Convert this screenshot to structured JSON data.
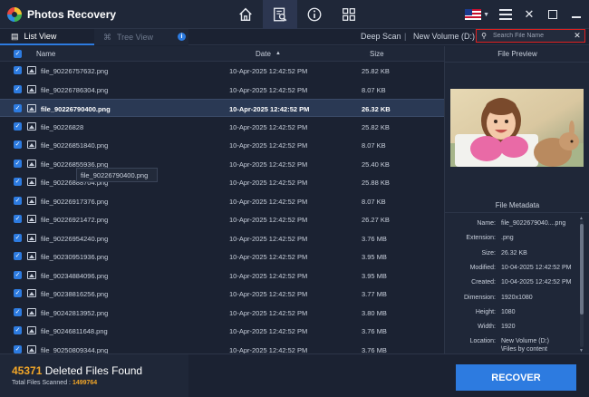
{
  "app": {
    "title": "Photos Recovery"
  },
  "nav": {
    "icons": [
      "home-icon",
      "scan-results-icon",
      "info-icon",
      "grid-icon"
    ]
  },
  "window": {
    "language_flag": "us-flag",
    "menu_icon": "hamburger-icon"
  },
  "tabs": [
    {
      "label": "List View",
      "active": true
    },
    {
      "label": "Tree View",
      "active": false
    }
  ],
  "scan": {
    "type": "Deep Scan",
    "separator": "|",
    "volume": "New Volume (D:)"
  },
  "search": {
    "placeholder": "Search File Name",
    "value": ""
  },
  "list": {
    "columns": {
      "name": "Name",
      "date": "Date",
      "size": "Size"
    },
    "sort": {
      "column": "date",
      "direction": "ascending"
    },
    "rows": [
      {
        "name": "file_90226757632.png",
        "date": "10-Apr-2025 12:42:52 PM",
        "size": "25.82 KB",
        "selected": false
      },
      {
        "name": "file_90226786304.png",
        "date": "10-Apr-2025 12:42:52 PM",
        "size": "8.07 KB",
        "selected": false
      },
      {
        "name": "file_90226790400.png",
        "date": "10-Apr-2025 12:42:52 PM",
        "size": "26.32 KB",
        "selected": true
      },
      {
        "name": "file_90226828",
        "date": "10-Apr-2025 12:42:52 PM",
        "size": "25.82 KB",
        "selected": false
      },
      {
        "name": "file_90226851840.png",
        "date": "10-Apr-2025 12:42:52 PM",
        "size": "8.07 KB",
        "selected": false
      },
      {
        "name": "file_90226855936.png",
        "date": "10-Apr-2025 12:42:52 PM",
        "size": "25.40 KB",
        "selected": false
      },
      {
        "name": "file_90226888704.png",
        "date": "10-Apr-2025 12:42:52 PM",
        "size": "25.88 KB",
        "selected": false
      },
      {
        "name": "file_90226917376.png",
        "date": "10-Apr-2025 12:42:52 PM",
        "size": "8.07 KB",
        "selected": false
      },
      {
        "name": "file_90226921472.png",
        "date": "10-Apr-2025 12:42:52 PM",
        "size": "26.27 KB",
        "selected": false
      },
      {
        "name": "file_90226954240.png",
        "date": "10-Apr-2025 12:42:52 PM",
        "size": "3.76 MB",
        "selected": false
      },
      {
        "name": "file_90230951936.png",
        "date": "10-Apr-2025 12:42:52 PM",
        "size": "3.95 MB",
        "selected": false
      },
      {
        "name": "file_90234884096.png",
        "date": "10-Apr-2025 12:42:52 PM",
        "size": "3.95 MB",
        "selected": false
      },
      {
        "name": "file_90238816256.png",
        "date": "10-Apr-2025 12:42:52 PM",
        "size": "3.77 MB",
        "selected": false
      },
      {
        "name": "file_90242813952.png",
        "date": "10-Apr-2025 12:42:52 PM",
        "size": "3.80 MB",
        "selected": false
      },
      {
        "name": "file_90246811648.png",
        "date": "10-Apr-2025 12:42:52 PM",
        "size": "3.76 MB",
        "selected": false
      },
      {
        "name": "file_90250809344.png",
        "date": "10-Apr-2025 12:42:52 PM",
        "size": "3.76 MB",
        "selected": false
      }
    ],
    "tooltip": "file_90226790400.png"
  },
  "preview": {
    "title": "File Preview"
  },
  "metadata": {
    "title": "File Metadata",
    "rows": [
      {
        "key": "Name:",
        "value": "file_9022679040....png"
      },
      {
        "key": "Extension:",
        "value": ".png"
      },
      {
        "key": "Size:",
        "value": "26.32 KB"
      },
      {
        "key": "Modified:",
        "value": "10-04-2025 12:42:52 PM"
      },
      {
        "key": "Created:",
        "value": "10-04-2025 12:42:52 PM"
      },
      {
        "key": "Dimension:",
        "value": "1920x1080"
      },
      {
        "key": "Height:",
        "value": "1080"
      },
      {
        "key": "Width:",
        "value": "1920"
      },
      {
        "key": "Location:",
        "value": "New Volume (D:)"
      },
      {
        "key": "",
        "value": "\\Files by content"
      }
    ]
  },
  "footer": {
    "count": "45371",
    "found_label": "Deleted Files Found",
    "scanned_label": "Total Files Scanned :",
    "scanned_value": "1499764",
    "recover_label": "RECOVER"
  },
  "colors": {
    "accent": "#2d7be0",
    "highlight": "#f2a628",
    "search_border": "#e02020",
    "background": "#1b2232"
  }
}
